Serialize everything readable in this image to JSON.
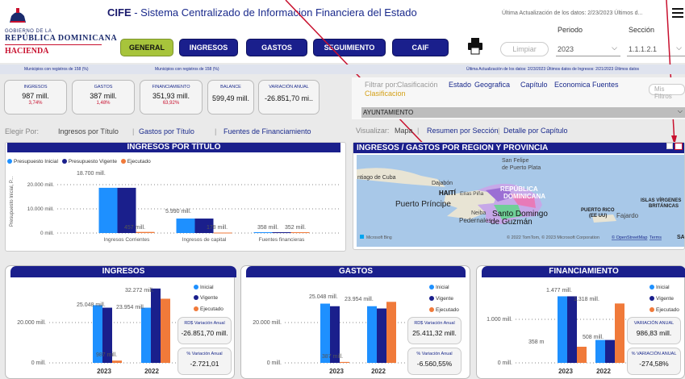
{
  "header": {
    "gov_line": "GOBIERNO DE LA",
    "country": "REPÚBLICA DOMINICANA",
    "ministry": "HACIENDA",
    "app_short": "CIFE",
    "app_title": " - Sistema Centralizado de Informacion Financiera del Estado",
    "last_update": "Última Actualización de los datos: 2/23/2023 Últimos d...",
    "period_label": "Periodo",
    "section_label": "Sección",
    "period_value": "2023",
    "section_value": "1.1.1.2.1"
  },
  "nav": [
    "GENERAL",
    "INGRESOS",
    "GASTOS",
    "SEGUIMIENTO",
    "CAIF"
  ],
  "clear_label": "Limpiar",
  "strip": {
    "left1": "Municipios con registros de 158 (%)",
    "left2": "Municipios con registros de 158 (%)",
    "right": "Última Actualización de los datos: 2/23/2023 Últimos datos de Ingresos: 2/21/2023 Últimos datos"
  },
  "kpis": [
    {
      "title": "INGRESOS",
      "value": "987 mill.",
      "pct": "3,74%"
    },
    {
      "title": "GASTOS",
      "value": "387 mill.",
      "pct": "1,48%"
    },
    {
      "title": "FINANCIAMIENTO",
      "value": "351,93 mill.",
      "pct": "63,92%"
    },
    {
      "title": "BALANCE",
      "value": "599,49 mill.",
      "pct": ""
    },
    {
      "title": "VARIACIÓN ANUAL",
      "value": "-26.851,70 mi..",
      "pct": ""
    }
  ],
  "filter": {
    "by_label": "Filtrar por:",
    "options": [
      "Clasificación",
      "Estado",
      "Geografica",
      "Capítulo",
      "Economica",
      "Fuentes"
    ],
    "highlight": "Clasificacion",
    "my_filters": "Mis Filtros",
    "selected": "AYUNTAMIENTO"
  },
  "choose": {
    "label": "Elegir Por:",
    "opt1": "Ingresos por Título",
    "opt2": "Gastos por Título",
    "opt3": "Fuentes de Financiamiento"
  },
  "visualize": {
    "label": "Visualizar:",
    "opt1": "Mapa",
    "opt2": "Resumen por Sección",
    "opt3": "Detalle por Capítulo"
  },
  "map": {
    "title": "INGRESOS / GASTOS POR REGION Y PROVINCIA",
    "labels": [
      "San Felipe",
      "de Puerto Plata",
      "ntiago de Cuba",
      "Dajabón",
      "HAITÍ",
      "Elías Piña",
      "REPÚBLICA",
      "DOMINICANA",
      "Puerto Príncipe",
      "Neiba",
      "Santo Domingo",
      "Pedernales",
      "de Guzmán",
      "PUERTO RICO",
      "(EE UU)",
      "Fajardo",
      "ISLAS VÍRGENES",
      "BRITÁNICAS",
      "SA"
    ],
    "bing": "Microsoft Bing",
    "copyright": "© 2022 TomTom, © 2023 Microsoft Corporation",
    "osm": "© OpenStreetMap",
    "terms": "Terms"
  },
  "chart_ingresos_titulo": {
    "title": "INGRESOS POR TÍTULO",
    "legend": [
      "Presupuesto Inicial",
      "Presupuesto Vigente",
      "Ejecutado"
    ],
    "ylabel": "Presupuesto Inicial, P...",
    "yticks": [
      "20.000 mill.",
      "10.000 mill.",
      "0 mill."
    ],
    "labels": {
      "c1_top": "18.700 mill.",
      "c1_exec": "457 mill.",
      "c2_top": "5.990 mill.",
      "c2_exec": "178 mill.",
      "c3_a": "358 mill.",
      "c3_b": "352 mill."
    }
  },
  "ingresos_card": {
    "title": "INGRESOS",
    "labels": {
      "v2022": "32.272 mill.",
      "i2023": "25.048 mill.",
      "v2023": "23.954 mill.",
      "e2023": "987 mill."
    },
    "yticks": [
      "20.000 mill.",
      "0 mill."
    ],
    "years": [
      "2023",
      "2022"
    ],
    "legend": [
      "Inicial",
      "Vigente",
      "Ejecutado"
    ],
    "box1_title": "RD$ Variación Anual",
    "box1_value": "-26.851,70 mill.",
    "box2_title": "% Variación Anual",
    "box2_value": "-2.721,01"
  },
  "gastos_card": {
    "title": "GASTOS",
    "labels": {
      "i2023": "25.048 mill.",
      "v2023": "23.954 mill.",
      "e2023": "387 mill."
    },
    "yticks": [
      "20.000 mill.",
      "0 mill."
    ],
    "years": [
      "2023",
      "2022"
    ],
    "legend": [
      "Inicial",
      "Vigente",
      "Ejecutado"
    ],
    "box1_title": "RD$ Variación Anual",
    "box1_value": "25.411,32 mill.",
    "box2_title": "% Variación Anual",
    "box2_value": "-6.560,55%"
  },
  "financ_card": {
    "title": "FINANCIAMIENTO",
    "labels": {
      "i2023": "1.477 mill.",
      "e2023": "358 m",
      "v2022": "508 mill.",
      "e2022": "1.318 mill."
    },
    "yticks": [
      "1.000 mill.",
      "0 mill."
    ],
    "years": [
      "2023",
      "2022"
    ],
    "legend": [
      "Inicial",
      "Vigente",
      "Ejecutado"
    ],
    "box1_title": "VARIACIÓN ANUAL",
    "box1_value": "986,83 mill.",
    "box2_title": "% VARIACIÓN ANUAL",
    "box2_value": "-274,58%"
  },
  "chart_data": [
    {
      "type": "bar",
      "title": "INGRESOS POR TÍTULO",
      "categories": [
        "Ingresos Corrientes",
        "Ingresos de capital",
        "Fuentes financieras"
      ],
      "series": [
        {
          "name": "Presupuesto Inicial",
          "values": [
            18700,
            5990,
            358
          ]
        },
        {
          "name": "Presupuesto Vigente",
          "values": [
            18700,
            5990,
            352
          ]
        },
        {
          "name": "Ejecutado",
          "values": [
            457,
            178,
            352
          ]
        }
      ],
      "ylim": [
        0,
        25000
      ],
      "colors": [
        "#1e90ff",
        "#1a1f8c",
        "#f07a3a"
      ]
    },
    {
      "type": "bar",
      "title": "INGRESOS",
      "categories": [
        "2023",
        "2022"
      ],
      "series": [
        {
          "name": "Inicial",
          "values": [
            25048,
            23954
          ]
        },
        {
          "name": "Vigente",
          "values": [
            23954,
            32272
          ]
        },
        {
          "name": "Ejecutado",
          "values": [
            987,
            27838
          ]
        }
      ],
      "ylim": [
        0,
        35000
      ]
    },
    {
      "type": "bar",
      "title": "GASTOS",
      "categories": [
        "2023",
        "2022"
      ],
      "series": [
        {
          "name": "Inicial",
          "values": [
            25048,
            23954
          ]
        },
        {
          "name": "Vigente",
          "values": [
            23954,
            23000
          ]
        },
        {
          "name": "Ejecutado",
          "values": [
            387,
            25798
          ]
        }
      ],
      "ylim": [
        0,
        30000
      ]
    },
    {
      "type": "bar",
      "title": "FINANCIAMIENTO",
      "categories": [
        "2023",
        "2022"
      ],
      "series": [
        {
          "name": "Inicial",
          "values": [
            1477,
            508
          ]
        },
        {
          "name": "Vigente",
          "values": [
            1477,
            508
          ]
        },
        {
          "name": "Ejecutado",
          "values": [
            358,
            1318
          ]
        }
      ],
      "ylim": [
        0,
        1700
      ]
    }
  ]
}
